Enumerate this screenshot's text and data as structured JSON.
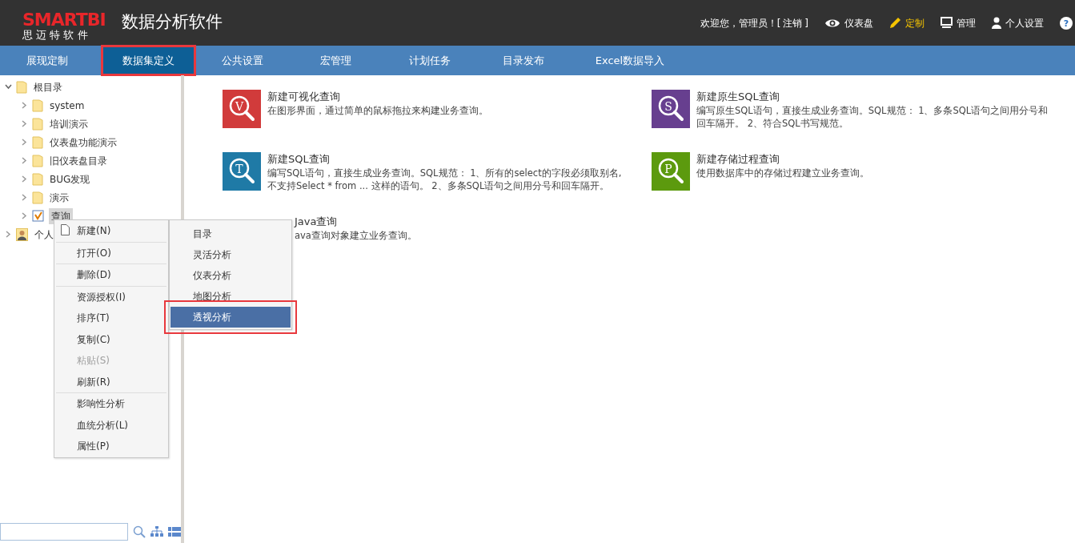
{
  "header": {
    "logo": "SMARTBI",
    "logo_subtitle": "思 迈 特 软 件",
    "title": "数据分析软件",
    "welcome": "欢迎您，管理员！[",
    "logout": "注销",
    "welcome_end": "]",
    "actions": [
      {
        "kind": "eye",
        "label": "仪表盘",
        "selected": false
      },
      {
        "kind": "pencil",
        "label": "定制",
        "selected": true
      },
      {
        "kind": "monitor",
        "label": "管理",
        "selected": false
      },
      {
        "kind": "person",
        "label": "个人设置",
        "selected": false
      },
      {
        "kind": "help",
        "glyph": "?"
      }
    ]
  },
  "tabs": [
    {
      "label": "展现定制",
      "selected": false,
      "highlighted": false
    },
    {
      "label": "数据集定义",
      "selected": true,
      "highlighted": true
    },
    {
      "label": "公共设置",
      "selected": false,
      "highlighted": false
    },
    {
      "label": "宏管理",
      "selected": false,
      "highlighted": false
    },
    {
      "label": "计划任务",
      "selected": false,
      "highlighted": false
    },
    {
      "label": "目录发布",
      "selected": false,
      "highlighted": false
    },
    {
      "label": "Excel数据导入",
      "selected": false,
      "highlighted": false
    }
  ],
  "tree": [
    {
      "label": "根目录",
      "kind": "folder",
      "expanded": true,
      "selected": false,
      "children": [
        {
          "label": "system",
          "kind": "folder",
          "expanded": false,
          "selected": false
        },
        {
          "label": "培训演示",
          "kind": "folder",
          "expanded": false,
          "selected": false
        },
        {
          "label": "仪表盘功能演示",
          "kind": "folder",
          "expanded": false,
          "selected": false
        },
        {
          "label": "旧仪表盘目录",
          "kind": "folder",
          "expanded": false,
          "selected": false
        },
        {
          "label": "BUG发现",
          "kind": "folder",
          "expanded": false,
          "selected": false
        },
        {
          "label": "演示",
          "kind": "folder",
          "expanded": false,
          "selected": false
        },
        {
          "label": "查询",
          "kind": "query",
          "expanded": false,
          "selected": true
        }
      ]
    },
    {
      "label": "个人",
      "kind": "user",
      "expanded": false,
      "selected": false
    }
  ],
  "cards": [
    {
      "title": "新建可视化查询",
      "description": "在图形界面，通过简单的鼠标拖拉来构建业务查询。",
      "icon_letter": "V",
      "color": "#d13b3b"
    },
    {
      "title": "新建原生SQL查询",
      "description": "编写原生SQL语句，直接生成业务查询。SQL规范： 1、多条SQL语句之间用分号和回车隔开。 2、符合SQL书写规范。",
      "icon_letter": "S",
      "color": "#673f8f"
    },
    {
      "title": "新建SQL查询",
      "description": "编写SQL语句，直接生成业务查询。SQL规范： 1、所有的select的字段必须取别名,不支持Select * from ... 这样的语句。 2、多条SQL语句之间用分号和回车隔开。",
      "icon_letter": "T",
      "color": "#1f7aa6"
    },
    {
      "title": "新建存储过程查询",
      "description": "使用数据库中的存储过程建立业务查询。",
      "icon_letter": "P",
      "color": "#5c9a0e"
    },
    {
      "title": "Java查询",
      "description": "ava查询对象建立业务查询。"
    }
  ],
  "context_menu": {
    "groups": [
      [
        {
          "label": "新建(N)",
          "icon": true,
          "disabled": false
        }
      ],
      [
        {
          "label": "打开(O)",
          "icon": false,
          "disabled": false
        }
      ],
      [
        {
          "label": "删除(D)",
          "icon": false,
          "disabled": false
        }
      ],
      [
        {
          "label": "资源授权(I)",
          "icon": false,
          "disabled": false
        },
        {
          "label": "排序(T)",
          "icon": false,
          "disabled": false
        },
        {
          "label": "复制(C)",
          "icon": false,
          "disabled": false
        },
        {
          "label": "粘贴(S)",
          "icon": false,
          "disabled": true
        },
        {
          "label": "刷新(R)",
          "icon": false,
          "disabled": false
        }
      ],
      [
        {
          "label": "影响性分析",
          "icon": false,
          "disabled": false
        },
        {
          "label": "血统分析(L)",
          "icon": false,
          "disabled": false
        },
        {
          "label": "属性(P)",
          "icon": false,
          "disabled": false
        }
      ]
    ]
  },
  "submenu": [
    {
      "label": "目录",
      "selected": false,
      "highlighted": false
    },
    {
      "label": "灵活分析",
      "selected": false,
      "highlighted": false
    },
    {
      "label": "仪表分析",
      "selected": false,
      "highlighted": false
    },
    {
      "label": "地图分析",
      "selected": false,
      "highlighted": false
    },
    {
      "label": "透视分析",
      "selected": true,
      "highlighted": true
    }
  ]
}
